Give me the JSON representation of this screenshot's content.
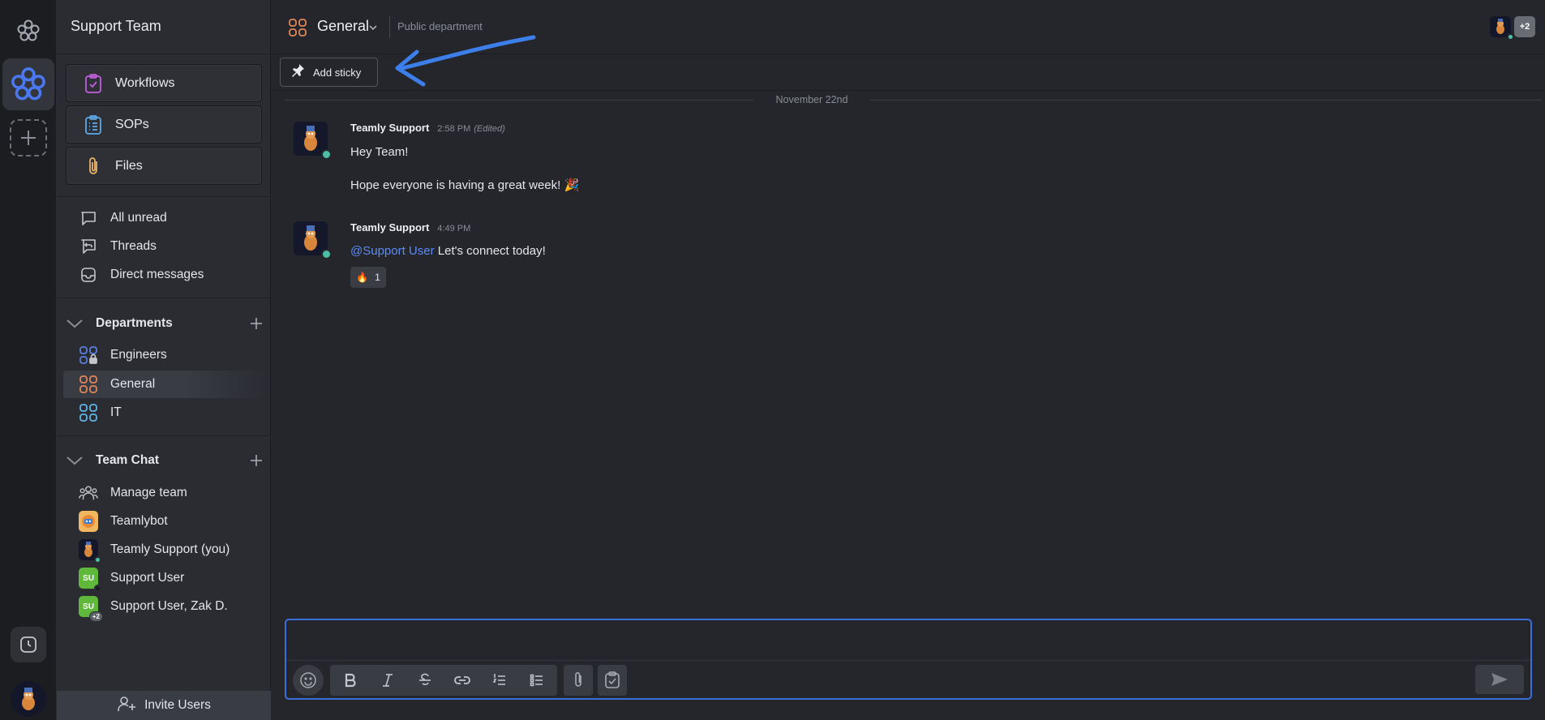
{
  "workspace": {
    "title": "Support Team"
  },
  "tools": [
    {
      "label": "Workflows",
      "icon": "clipboard-check-icon"
    },
    {
      "label": "SOPs",
      "icon": "clipboard-list-icon"
    },
    {
      "label": "Files",
      "icon": "paperclip-icon"
    }
  ],
  "nav": {
    "all_unread": "All unread",
    "threads": "Threads",
    "direct_messages": "Direct messages"
  },
  "departments": {
    "label": "Departments",
    "items": [
      {
        "label": "Engineers",
        "color": "#5b7fe0"
      },
      {
        "label": "General",
        "color": "#e0875a"
      },
      {
        "label": "IT",
        "color": "#5fb4e8"
      }
    ]
  },
  "team_chat": {
    "label": "Team Chat",
    "items": [
      {
        "label": "Manage team"
      },
      {
        "label": "Teamlybot"
      },
      {
        "label": "Teamly Support (you)"
      },
      {
        "label": "Support User",
        "initials": "SU"
      },
      {
        "label": "Support User, Zak D.",
        "initials": "SU",
        "badge": "+2"
      }
    ]
  },
  "invite": {
    "label": "Invite Users"
  },
  "channel": {
    "name": "General",
    "description": "Public department",
    "members_more": "+2"
  },
  "sticky": {
    "label": "Add sticky"
  },
  "date_separator": "November 22nd",
  "messages": [
    {
      "author": "Teamly Support",
      "time": "2:58 PM",
      "edited": "(Edited)",
      "lines": [
        "Hey Team!",
        "Hope everyone is having a great week! 🎉"
      ]
    },
    {
      "author": "Teamly Support",
      "time": "4:49 PM",
      "mention": "@Support User",
      "text": "Let's connect today!",
      "reaction": {
        "emoji": "🔥",
        "count": "1"
      }
    }
  ],
  "composer": {
    "placeholder": ""
  },
  "colors": {
    "accent": "#3b6fd8",
    "online": "#4dbfa6",
    "mention": "#5b8cf5",
    "su_green": "#5fb83a"
  }
}
